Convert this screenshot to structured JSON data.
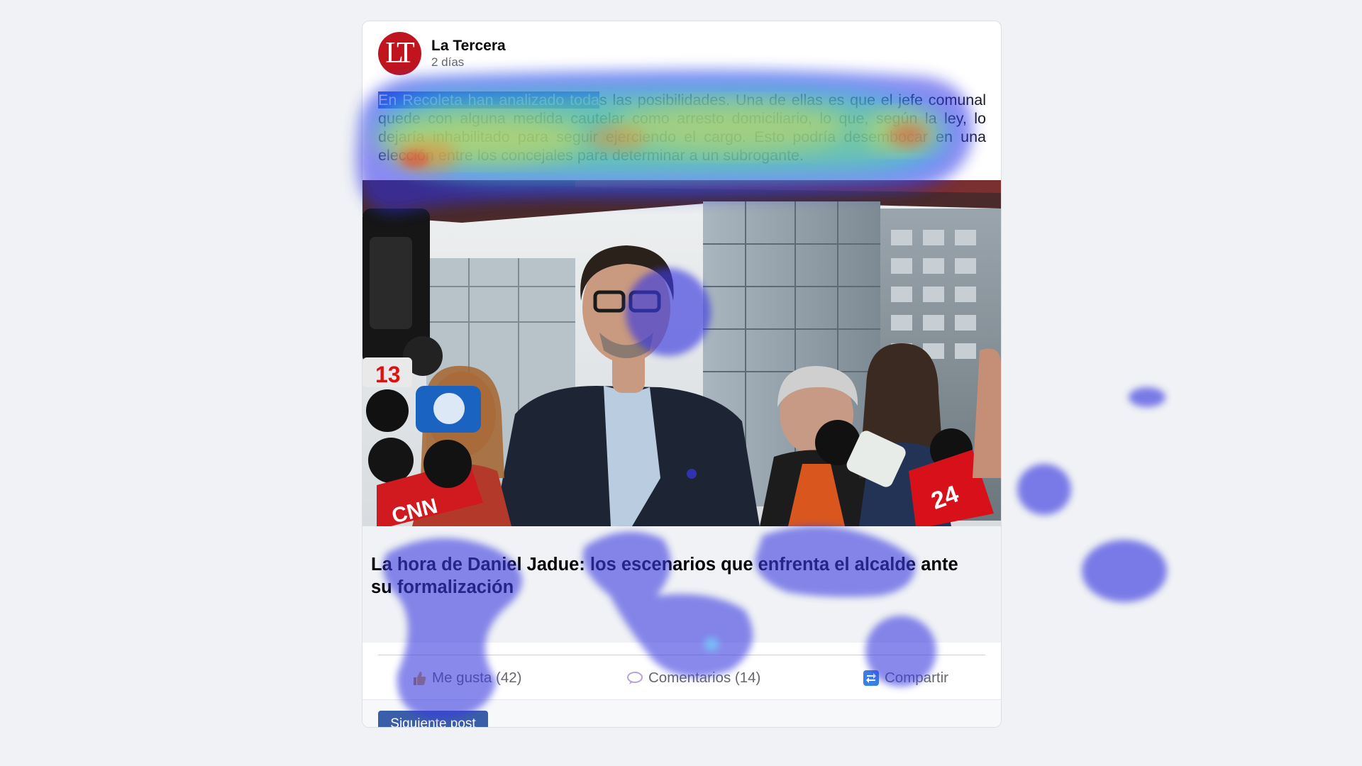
{
  "post": {
    "page_name": "La Tercera",
    "logo_text": "LT",
    "time": "2 días",
    "text_highlighted": "En Recoleta han analizado toda",
    "text_rest": "s las posibilidades. Una de ellas es que el jefe comunal quede con alguna medida cautelar como arresto domiciliario, lo que, según la ley, lo dejaría inhabilitado para seguir ejerciendo el cargo. Esto podría desembocar en una elección entre los concejales para determinar a un subrogante.",
    "link_title": "La hora de Daniel Jadue: los escenarios que enfrenta el alcalde ante su formalización"
  },
  "actions": {
    "like": {
      "label": "Me gusta (42)",
      "icon": "thumbs-up-icon"
    },
    "comment": {
      "label": "Comentarios (14)",
      "icon": "speech-bubble-icon"
    },
    "share": {
      "label": "Compartir",
      "icon": "share-icon"
    }
  },
  "footer": {
    "next_label": "Siguiente post"
  },
  "overlay": {
    "type": "attention heatmap"
  },
  "colors": {
    "brand": "#c0151e",
    "button": "#3b5ea8",
    "selection": "#2f6fde",
    "page_bg": "#f0f2f5"
  }
}
